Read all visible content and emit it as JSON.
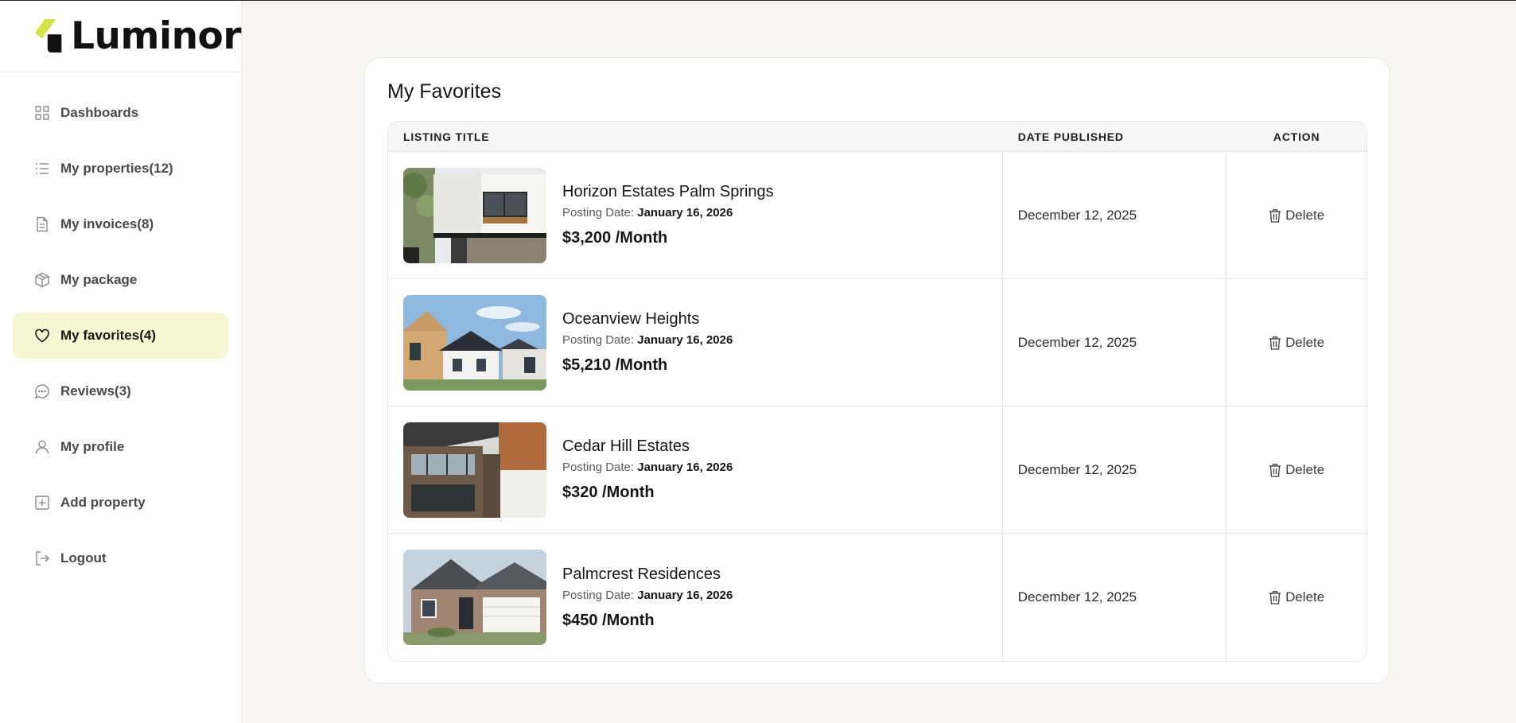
{
  "brand": {
    "name": "Luminor",
    "mark_color": "#d4e34a"
  },
  "sidebar": {
    "items": [
      {
        "label": "Dashboards",
        "icon": "grid-icon"
      },
      {
        "label": "My properties(12)",
        "icon": "list-icon"
      },
      {
        "label": "My invoices(8)",
        "icon": "document-icon"
      },
      {
        "label": "My package",
        "icon": "package-icon"
      },
      {
        "label": "My favorites(4)",
        "icon": "heart-icon",
        "active": true
      },
      {
        "label": "Reviews(3)",
        "icon": "chat-icon"
      },
      {
        "label": "My profile",
        "icon": "user-icon"
      },
      {
        "label": "Add property",
        "icon": "plus-square-icon"
      },
      {
        "label": "Logout",
        "icon": "logout-icon"
      }
    ],
    "active_color": "#f8f7d4"
  },
  "main": {
    "title": "My Favorites",
    "table": {
      "headers": {
        "title": "LISTING TITLE",
        "date": "DATE PUBLISHED",
        "action": "ACTION"
      },
      "posting_label": "Posting Date:",
      "delete_label": "Delete",
      "rows": [
        {
          "title": "Horizon Estates Palm Springs",
          "posting_date": "January 16, 2026",
          "price": "$3,200 /Month",
          "date_published": "December 12, 2025",
          "image": "modern-white-house-photo"
        },
        {
          "title": "Oceanview Heights",
          "posting_date": "January 16, 2026",
          "price": "$5,210 /Month",
          "date_published": "December 12, 2025",
          "image": "wooden-houses-blue-sky-photo"
        },
        {
          "title": "Cedar Hill Estates",
          "posting_date": "January 16, 2026",
          "price": "$320 /Month",
          "date_published": "December 12, 2025",
          "image": "brick-apartment-photo"
        },
        {
          "title": "Palmcrest Residences",
          "posting_date": "January 16, 2026",
          "price": "$450 /Month",
          "date_published": "December 12, 2025",
          "image": "suburban-house-garage-photo"
        }
      ]
    }
  }
}
